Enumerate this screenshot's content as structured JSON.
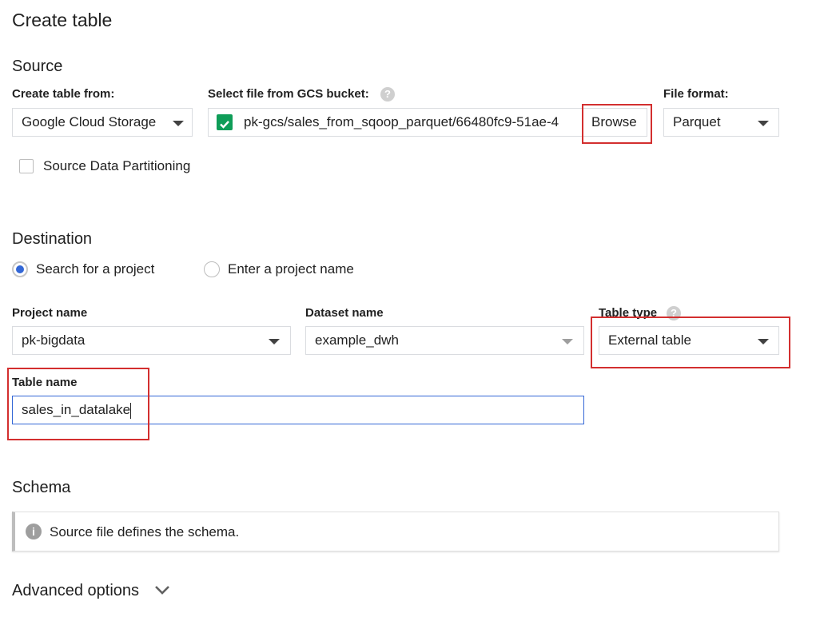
{
  "page": {
    "title": "Create table"
  },
  "source": {
    "heading": "Source",
    "create_from_label": "Create table from:",
    "create_from_value": "Google Cloud Storage",
    "gcs_label": "Select file from GCS bucket:",
    "gcs_path": "pk-gcs/sales_from_sqoop_parquet/66480fc9-51ae-4",
    "browse_label": "Browse",
    "file_format_label": "File format:",
    "file_format_value": "Parquet",
    "partition_label": "Source Data Partitioning"
  },
  "destination": {
    "heading": "Destination",
    "radio_search": "Search for a project",
    "radio_enter": "Enter a project name",
    "project_label": "Project name",
    "project_value": "pk-bigdata",
    "dataset_label": "Dataset name",
    "dataset_value": "example_dwh",
    "table_type_label": "Table type",
    "table_type_value": "External table",
    "table_name_label": "Table name",
    "table_name_value": "sales_in_datalake"
  },
  "schema": {
    "heading": "Schema",
    "info_text": "Source file defines the schema."
  },
  "advanced": {
    "label": "Advanced options"
  },
  "icons": {
    "help": "help-icon",
    "check": "check-icon",
    "info": "info-icon",
    "chevron": "chevron-down-icon"
  },
  "colors": {
    "accent_blue": "#3367d6",
    "check_green": "#0f9d58",
    "highlight_red": "#d32f2f"
  }
}
